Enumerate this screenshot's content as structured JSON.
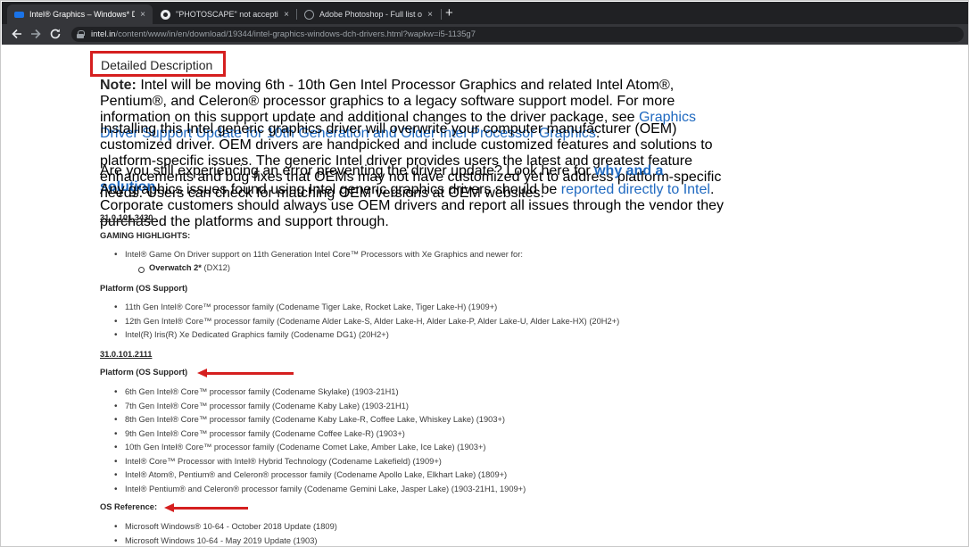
{
  "browser": {
    "tabs": [
      {
        "title": "Intel® Graphics – Windows* DCH",
        "favicon_color": "#1a73e8"
      },
      {
        "title": "\"PHOTOSCAPE\" not accepting sh",
        "favicon_color": "#e8eaed"
      },
      {
        "title": "Adobe Photoshop - Full list of Sh",
        "favicon_color": "#9aa0a6"
      }
    ],
    "tab_close_glyph": "×",
    "new_tab_glyph": "+",
    "url_host": "intel.in",
    "url_path": "/content/www/in/en/download/19344/intel-graphics-windows-dch-drivers.html?wapkw=i5-1135g7"
  },
  "page": {
    "heading": "Detailed Description",
    "note_label": "Note:",
    "note_text": " Intel will be moving 6th - 10th Gen Intel Processor Graphics and related Intel Atom®, Pentium®, and Celeron® processor graphics to a legacy software support model. For more information on this support update and additional changes to the driver package, see ",
    "note_link": "Graphics Driver Support Update for 10th Generation and Older Intel Processor Graphics",
    "note_end": ".",
    "para2": "Installing this Intel generic graphics driver will overwrite your computer manufacturer (OEM) customized driver. OEM drivers are handpicked and include customized features and solutions to platform-specific issues. The generic Intel driver provides users the latest and greatest feature enhancements and bug fixes that OEMs may not have customized yet to address platform-specific needs. Users can check for matching OEM versions at OEM websites.",
    "para3_text": "Are you still experiencing an error preventing the driver update? Look here for ",
    "para3_link": "why and a solution",
    "para3_end": ".",
    "para4_text": "Any graphics issues found using Intel generic graphics drivers should be ",
    "para4_link": "reported directly to Intel",
    "para4_end": ". Corporate customers should always use OEM drivers and report all issues through the vendor they purchased the platforms and support through.",
    "version1": "31.0.101.3430",
    "gaming_heading": "GAMING HIGHLIGHTS:",
    "gaming_items": [
      "Intel® Game On Driver support on 11th Generation Intel Core™ Processors with Xe Graphics and newer for:"
    ],
    "gaming_sub_bold": "Overwatch 2*",
    "gaming_sub_rest": " (DX12)",
    "platform_heading_1": "Platform (OS Support)",
    "platform_items_1": [
      "11th Gen Intel® Core™ processor family (Codename Tiger Lake, Rocket Lake, Tiger Lake-H) (1909+)",
      "12th Gen Intel® Core™ processor family (Codename Alder Lake-S, Alder Lake-H, Alder Lake-P, Alder Lake-U, Alder Lake-HX) (20H2+)",
      "Intel(R) Iris(R) Xe Dedicated Graphics family (Codename DG1) (20H2+)"
    ],
    "version2": "31.0.101.2111",
    "platform_heading_2": "Platform (OS Support)",
    "platform_items_2": [
      "6th Gen Intel® Core™ processor family (Codename Skylake) (1903-21H1)",
      "7th Gen Intel® Core™ processor family (Codename Kaby Lake) (1903-21H1)",
      "8th Gen Intel® Core™ processor family (Codename Kaby Lake-R, Coffee Lake, Whiskey Lake) (1903+)",
      "9th Gen Intel® Core™ processor family (Codename Coffee Lake-R) (1903+)",
      "10th Gen Intel® Core™ processor family (Codename Comet Lake, Amber Lake, Ice Lake) (1903+)",
      "Intel® Core™ Processor with Intel® Hybrid Technology (Codename Lakefield) (1909+)",
      "Intel® Atom®, Pentium® and Celeron® processor family (Codename Apollo Lake, Elkhart Lake) (1809+)",
      "Intel® Pentium® and Celeron® processor family (Codename Gemini Lake, Jasper Lake) (1903-21H1, 1909+)"
    ],
    "os_heading": "OS Reference:",
    "os_items": [
      "Microsoft Windows® 10-64 - October 2018 Update (1809)",
      "Microsoft Windows 10-64 - May 2019 Update (1903)"
    ]
  },
  "annotation_color": "#d51f1f"
}
